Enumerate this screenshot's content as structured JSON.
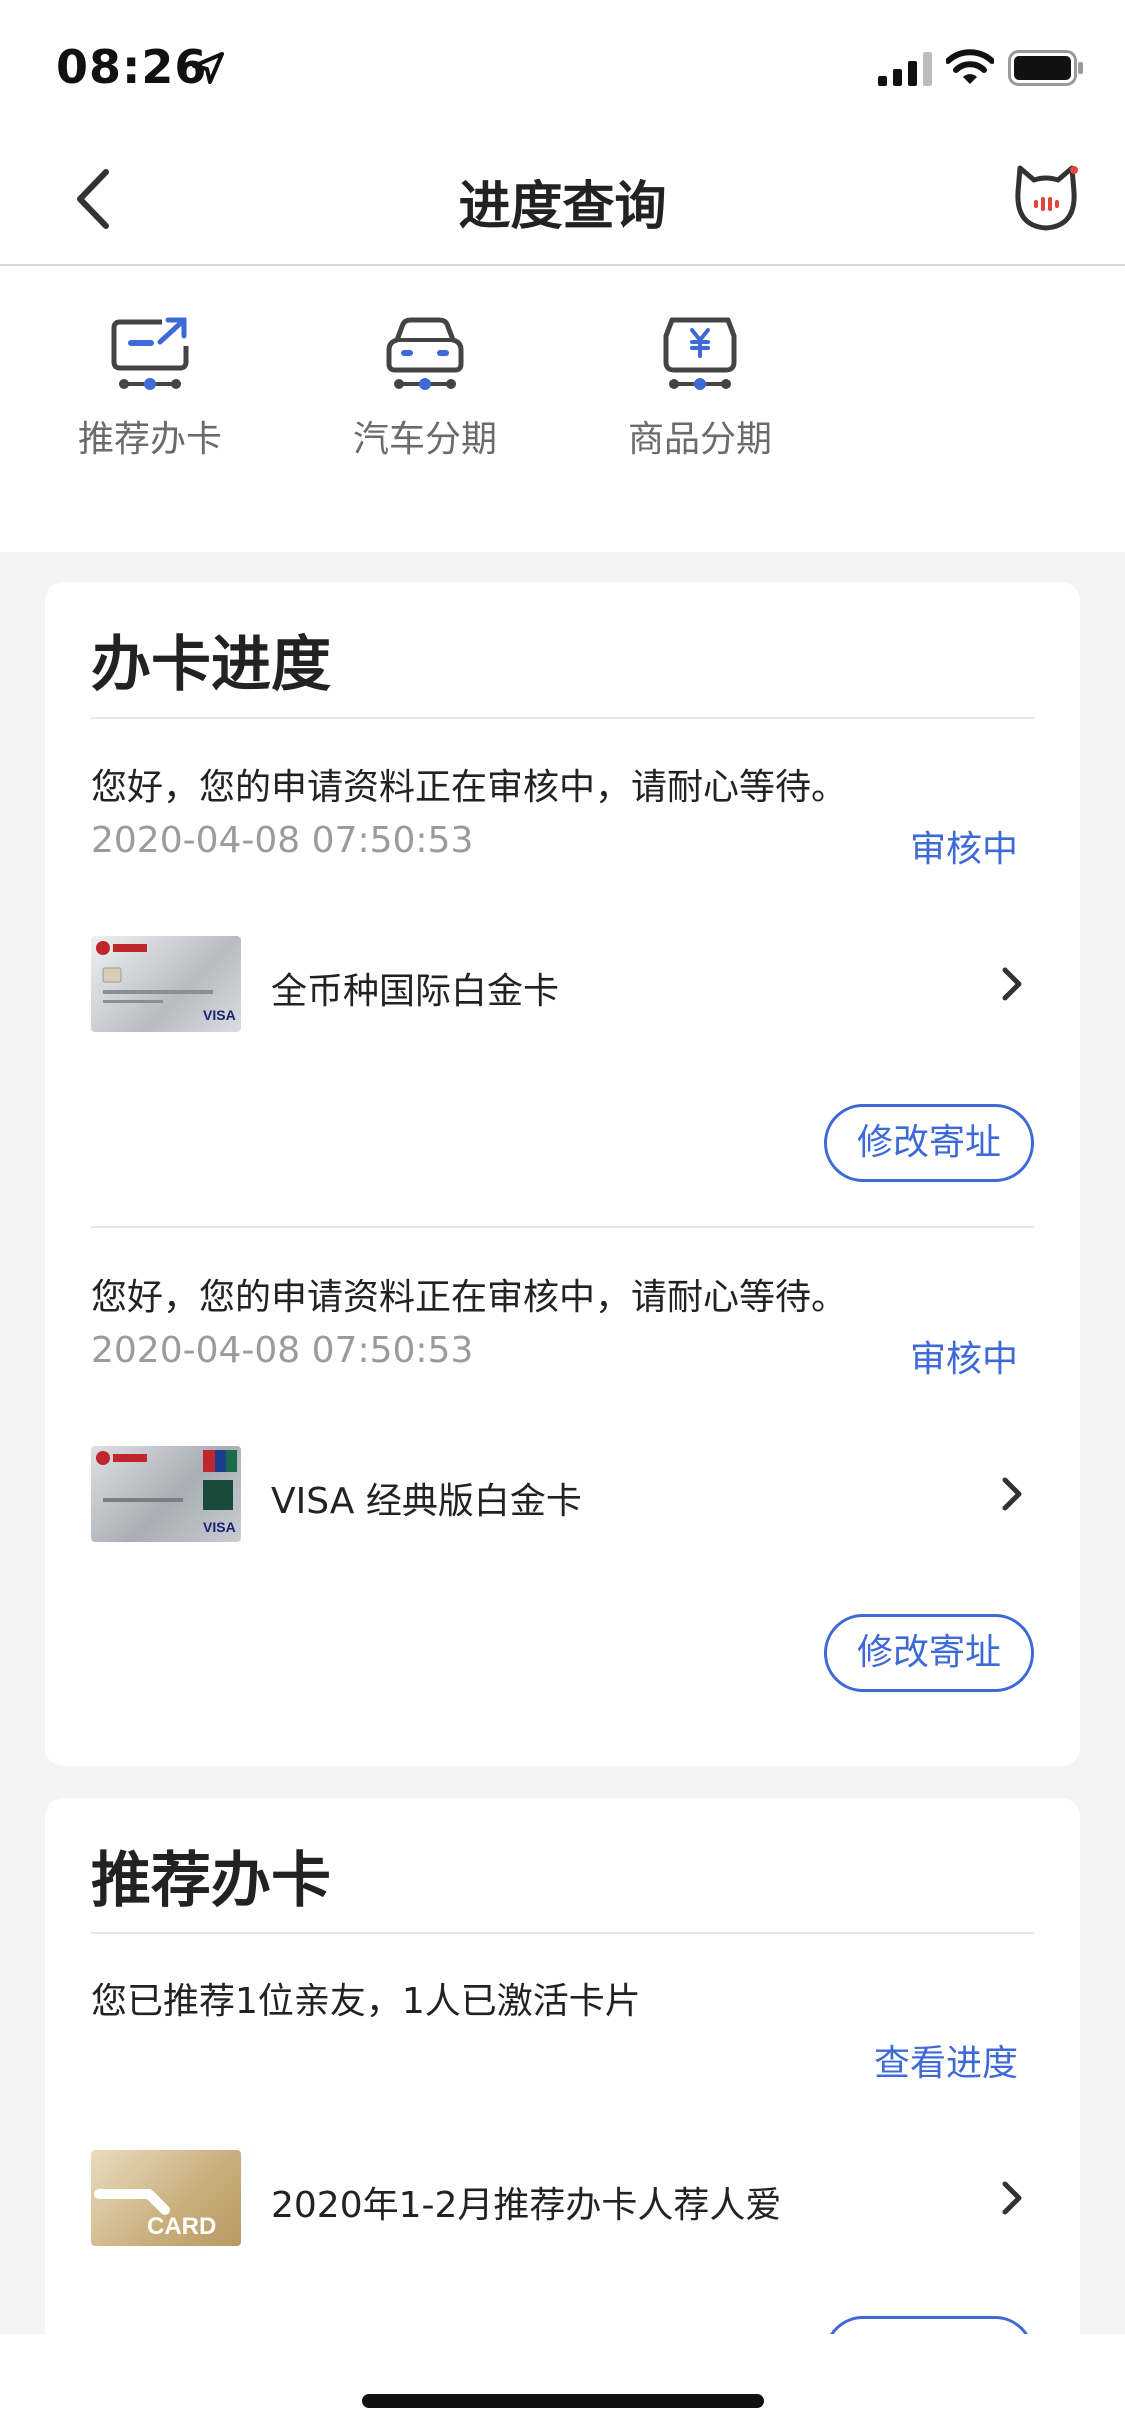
{
  "status_bar": {
    "time": "08:26"
  },
  "nav": {
    "title": "进度查询"
  },
  "shortcuts": [
    {
      "label": "推荐办卡",
      "icon": "card-refer-icon"
    },
    {
      "label": "汽车分期",
      "icon": "car-icon"
    },
    {
      "label": "商品分期",
      "icon": "yen-box-icon"
    }
  ],
  "progress": {
    "title": "办卡进度",
    "items": [
      {
        "message": "您好，您的申请资料正在审核中，请耐心等待。",
        "date": "2020-04-08 07:50:53",
        "status": "审核中",
        "card_name": "全币种国际白金卡",
        "button": "修改寄址"
      },
      {
        "message": "您好，您的申请资料正在审核中，请耐心等待。",
        "date": "2020-04-08 07:50:53",
        "status": "审核中",
        "card_name": "VISA 经典版白金卡",
        "button": "修改寄址"
      }
    ]
  },
  "recommend": {
    "title": "推荐办卡",
    "message": "您已推荐1位亲友，1人已激活卡片",
    "link": "查看进度",
    "item_name": "2020年1-2月推荐办卡人荐人爱",
    "item_thumb_text": "CARD"
  },
  "colors": {
    "accent": "#3e6ad8",
    "background": "#f4f4f5"
  }
}
